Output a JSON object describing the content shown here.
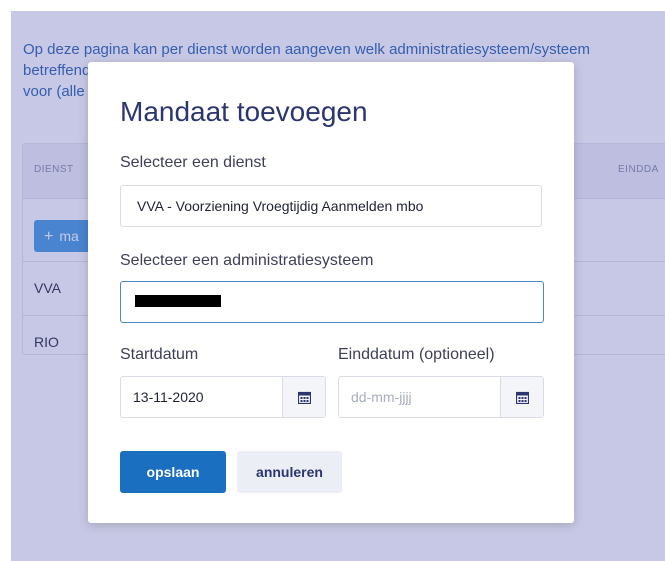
{
  "page": {
    "intro_line1": "Op deze pagina kan per dienst worden aangeven welk administratiesysteem/systeem",
    "intro_line2": "betreffend de gegevens",
    "intro_line3": "voor (alle",
    "table": {
      "columns": [
        "DIENST",
        "EINDDA"
      ],
      "add_button_label": "ma",
      "rows": [
        "VVA",
        "RIO"
      ]
    }
  },
  "modal": {
    "title": "Mandaat toevoegen",
    "dienst_label": "Selecteer een dienst",
    "dienst_value": "VVA - Voorziening Vroegtijdig Aanmelden mbo",
    "admin_label": "Selecteer een administratiesysteem",
    "start_label": "Startdatum",
    "start_value": "13-11-2020",
    "end_label": "Einddatum (optioneel)",
    "end_placeholder": "dd-mm-jjjj",
    "save_label": "opslaan",
    "cancel_label": "annuleren"
  },
  "colors": {
    "accent": "#1a6fc0",
    "title": "#2b3570",
    "overlay": "#4648aa"
  },
  "icons": {
    "calendar": "calendar-icon",
    "plus": "plus-icon"
  }
}
